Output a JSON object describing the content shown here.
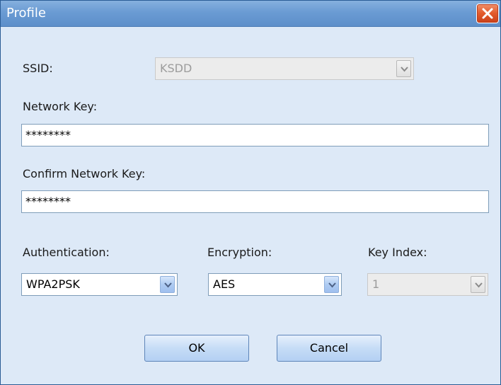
{
  "window": {
    "title": "Profile"
  },
  "form": {
    "ssid": {
      "label": "SSID:",
      "value": "KSDD",
      "enabled": false
    },
    "network_key": {
      "label": "Network Key:",
      "value": "********"
    },
    "confirm_network_key": {
      "label": "Confirm Network Key:",
      "value": "********"
    },
    "authentication": {
      "label": "Authentication:",
      "value": "WPA2PSK",
      "enabled": true
    },
    "encryption": {
      "label": "Encryption:",
      "value": "AES",
      "enabled": true
    },
    "key_index": {
      "label": "Key Index:",
      "value": "1",
      "enabled": false
    }
  },
  "buttons": {
    "ok": "OK",
    "cancel": "Cancel"
  },
  "icons": {
    "close": "close-icon",
    "dropdown": "chevron-down-icon"
  },
  "colors": {
    "titlebar": "#6a9bd3",
    "dialog_background": "#dde9f7",
    "close_button": "#e35a2b",
    "button_face": "#c6dcf6"
  }
}
